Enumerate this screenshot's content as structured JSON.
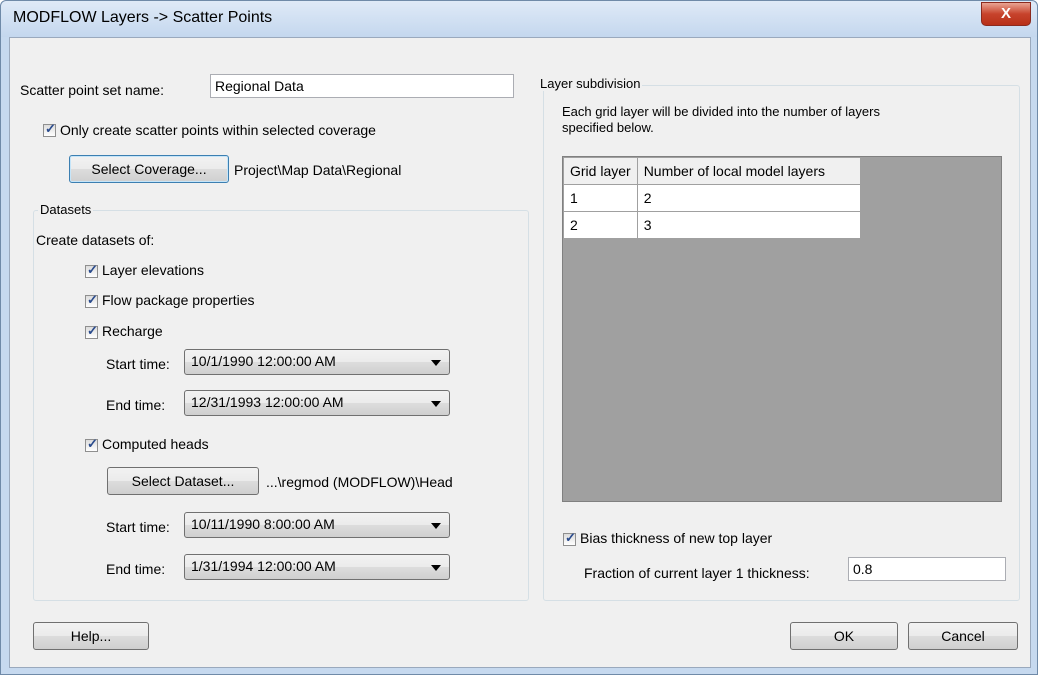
{
  "window": {
    "title": "MODFLOW Layers -> Scatter Points",
    "close_glyph": "X"
  },
  "left": {
    "scatter_label": "Scatter point set name:",
    "scatter_value": "Regional Data",
    "only_within_label": "Only create scatter points within selected coverage",
    "only_within_checked": true,
    "select_coverage_label": "Select Coverage...",
    "coverage_path": "Project\\Map Data\\Regional",
    "datasets": {
      "group_title": "Datasets",
      "create_label": "Create datasets of:",
      "layer_elevations_label": "Layer elevations",
      "flow_package_label": "Flow package properties",
      "recharge_label": "Recharge",
      "recharge_start_label": "Start time:",
      "recharge_start_value": "10/1/1990 12:00:00 AM",
      "recharge_end_label": "End time:",
      "recharge_end_value": "12/31/1993 12:00:00 AM",
      "computed_heads_label": "Computed heads",
      "select_dataset_label": "Select Dataset...",
      "dataset_path": "...\\regmod (MODFLOW)\\Head",
      "heads_start_label": "Start time:",
      "heads_start_value": "10/11/1990 8:00:00 AM",
      "heads_end_label": "End time:",
      "heads_end_value": "1/31/1994 12:00:00 AM"
    }
  },
  "right": {
    "group_title": "Layer subdivision",
    "description_line1": "Each grid layer will be divided into the number of layers",
    "description_line2": "specified below.",
    "table": {
      "headers": [
        "Grid layer",
        "Number of local model layers"
      ],
      "rows": [
        [
          "1",
          "2"
        ],
        [
          "2",
          "3"
        ]
      ]
    },
    "bias_label": "Bias thickness of new top layer",
    "fraction_label": "Fraction of current layer 1 thickness:",
    "fraction_value": "0.8"
  },
  "footer": {
    "help_label": "Help...",
    "ok_label": "OK",
    "cancel_label": "Cancel"
  },
  "icons": {
    "checkmark": "✓"
  },
  "colors": {
    "close_button": "#c7432c",
    "grid_background": "#a0a0a0",
    "title_bar": "#c4d7ee"
  }
}
